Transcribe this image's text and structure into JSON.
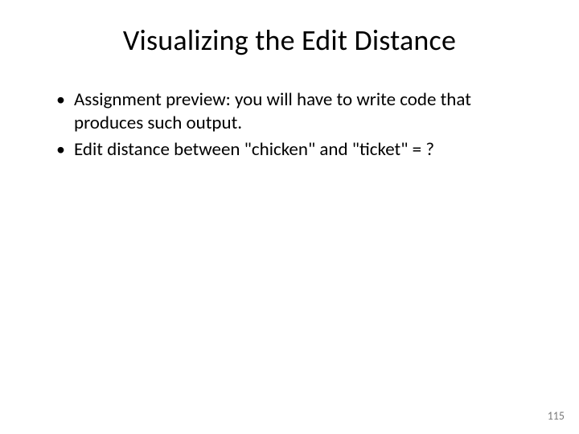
{
  "slide": {
    "title": "Visualizing the Edit Distance",
    "bullets": [
      "Assignment preview: you will have to write code that produces such output.",
      "Edit distance between \"chicken\" and \"ticket\" = ?"
    ],
    "page_number": "115"
  }
}
